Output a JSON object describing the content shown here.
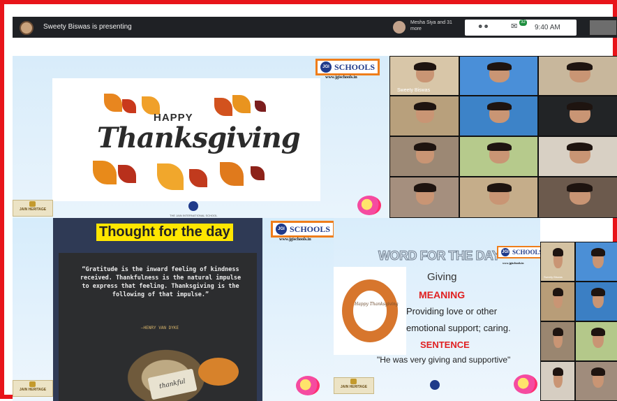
{
  "meet": {
    "presenting_text": "Sweety Biswas is presenting",
    "viewers_text": "Mesha Siya and 31 more",
    "time": "9:40 AM",
    "chat_badge": "32",
    "participants_icon": "people-icon",
    "chat_icon": "chat-icon"
  },
  "slide_top": {
    "badge_text": "SCHOOLS",
    "badge_logo": "JGI",
    "url": "www.jgischools.in",
    "happy": "HAPPY",
    "thanksgiving": "Thanksgiving",
    "heritage": "JAIN HERITAGE",
    "school_line": "THE JAIN INTERNATIONAL SCHOOL",
    "small_logo": "JGI"
  },
  "participants": [
    {
      "name": "Sweety Biswas",
      "bg": "#d8c6a8"
    },
    {
      "name": "",
      "bg": "#4a8fd8"
    },
    {
      "name": "",
      "bg": "#c8b79c"
    },
    {
      "name": "",
      "bg": "#b8a07c"
    },
    {
      "name": "",
      "bg": "#3d83c8"
    },
    {
      "name": "",
      "bg": "#222426"
    },
    {
      "name": "",
      "bg": "#9c8874"
    },
    {
      "name": "",
      "bg": "#b6ca8c"
    },
    {
      "name": "",
      "bg": "#d8d0c4"
    },
    {
      "name": "",
      "bg": "#a58f7e"
    },
    {
      "name": "",
      "bg": "#c5ad8a"
    },
    {
      "name": "",
      "bg": "#6c5a4d"
    }
  ],
  "slide_thought": {
    "title": "Thought for the day",
    "quote": "“Gratitude is the inward feeling of kindness received. Thankfulness is the natural impulse to express that feeling. Thanksgiving is the following of that impulse.”",
    "author": "—HENRY VAN DYKE",
    "tag": "thankful",
    "badge_text": "SCHOOLS",
    "badge_logo": "JGI",
    "url": "www.jgischools.in",
    "heritage": "JAIN HERITAGE"
  },
  "slide_word": {
    "title": "WORD FOR THE DAY",
    "badge_text": "SCHOOLS",
    "badge_logo": "JGI",
    "url": "www.jgischools.in",
    "word": "Giving",
    "meaning_label": "MEANING",
    "definition_line1": "Providing love or other",
    "definition_line2": "emotional support; caring.",
    "sentence_label": "SENTENCE",
    "example": "\"He was very giving and supportive\"",
    "card_text": "Happy Thanksgiving",
    "heritage": "JAIN HERITAGE"
  },
  "participants_small": [
    {
      "name": "Sweety Biswas",
      "bg": "#d4c2a2"
    },
    {
      "name": "",
      "bg": "#4b8fd6"
    },
    {
      "name": "",
      "bg": "#b89d78"
    },
    {
      "name": "",
      "bg": "#3b7fc4"
    },
    {
      "name": "",
      "bg": "#9a8670"
    },
    {
      "name": "",
      "bg": "#b4c88a"
    },
    {
      "name": "",
      "bg": "#d6cec2"
    },
    {
      "name": "",
      "bg": "#a08c7c"
    }
  ]
}
